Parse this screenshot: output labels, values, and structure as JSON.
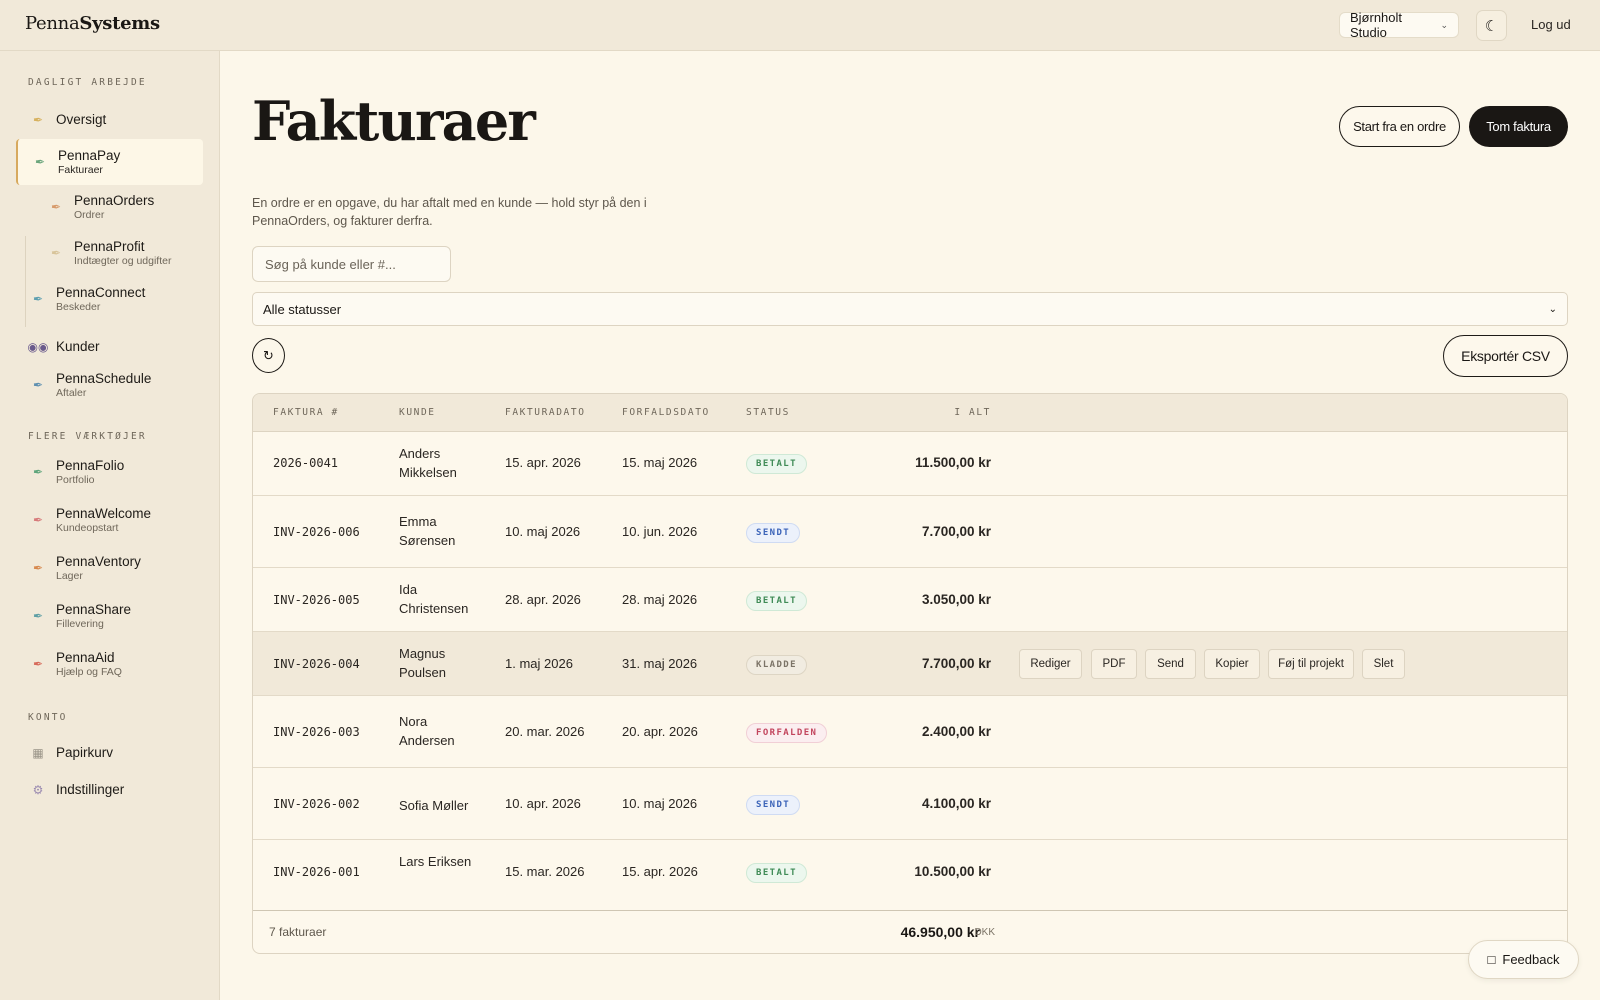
{
  "brand": {
    "light": "Penna",
    "bold": "Systems"
  },
  "header": {
    "workspace": "Bjørnholt Studio",
    "theme_icon": "moon-icon",
    "logout": "Log ud"
  },
  "sidebar": {
    "sections": [
      "DAGLIGT ARBEJDE",
      "FLERE VÆRKTØJER",
      "KONTO"
    ],
    "items": [
      {
        "label": "Oversigt",
        "sub": "",
        "icon": "quill-icon"
      },
      {
        "label": "PennaPay",
        "sub": "Fakturaer",
        "icon": "quill-icon"
      },
      {
        "label": "PennaOrders",
        "sub": "Ordrer",
        "icon": "quill-icon"
      },
      {
        "label": "PennaProfit",
        "sub": "Indtægter og udgifter",
        "icon": "quill-icon"
      },
      {
        "label": "PennaConnect",
        "sub": "Beskeder",
        "icon": "quill-icon"
      },
      {
        "label": "Kunder",
        "sub": "",
        "icon": "people-icon"
      },
      {
        "label": "PennaSchedule",
        "sub": "Aftaler",
        "icon": "quill-icon"
      },
      {
        "label": "PennaFolio",
        "sub": "Portfolio",
        "icon": "quill-icon"
      },
      {
        "label": "PennaWelcome",
        "sub": "Kundeopstart",
        "icon": "quill-icon"
      },
      {
        "label": "PennaVentory",
        "sub": "Lager",
        "icon": "quill-icon"
      },
      {
        "label": "PennaShare",
        "sub": "Fillevering",
        "icon": "quill-icon"
      },
      {
        "label": "PennaAid",
        "sub": "Hjælp og FAQ",
        "icon": "quill-icon"
      },
      {
        "label": "Papirkurv",
        "sub": "",
        "icon": "trash-icon"
      },
      {
        "label": "Indstillinger",
        "sub": "",
        "icon": "gear-icon"
      }
    ]
  },
  "main": {
    "title": "Fakturaer",
    "btn_from_order": "Start fra en ordre",
    "btn_blank": "Tom faktura",
    "intro": "En ordre er en opgave, du har aftalt med en kunde — hold styr på den i PennaOrders, og fakturer derfra.",
    "search_placeholder": "Søg på kunde eller #...",
    "status_filter": "Alle statusser",
    "export": "Eksportér CSV"
  },
  "table": {
    "headers": [
      "FAKTURA #",
      "KUNDE",
      "FAKTURADATO",
      "FORFALDSDATO",
      "STATUS",
      "I ALT"
    ],
    "rows": [
      {
        "id": "2026-0041",
        "kunde": "Anders Mikkelsen",
        "fdate": "15. apr. 2026",
        "ddate": "15. maj 2026",
        "status": "BETALT",
        "total": "11.500,00 kr"
      },
      {
        "id": "INV-2026-006",
        "kunde": "Emma Sørensen",
        "fdate": "10. maj 2026",
        "ddate": "10. jun. 2026",
        "status": "SENDT",
        "total": "7.700,00 kr"
      },
      {
        "id": "INV-2026-005",
        "kunde": "Ida Christensen",
        "fdate": "28. apr. 2026",
        "ddate": "28. maj 2026",
        "status": "BETALT",
        "total": "3.050,00 kr"
      },
      {
        "id": "INV-2026-004",
        "kunde": "Magnus Poulsen",
        "fdate": "1. maj 2026",
        "ddate": "31. maj 2026",
        "status": "KLADDE",
        "total": "7.700,00 kr"
      },
      {
        "id": "INV-2026-003",
        "kunde": "Nora Andersen",
        "fdate": "20. mar. 2026",
        "ddate": "20. apr. 2026",
        "status": "FORFALDEN",
        "total": "2.400,00 kr"
      },
      {
        "id": "INV-2026-002",
        "kunde": "Sofia Møller",
        "fdate": "10. apr. 2026",
        "ddate": "10. maj 2026",
        "status": "SENDT",
        "total": "4.100,00 kr"
      },
      {
        "id": "INV-2026-001",
        "kunde": "Lars Eriksen",
        "fdate": "15. mar. 2026",
        "ddate": "15. apr. 2026",
        "status": "BETALT",
        "total": "10.500,00 kr"
      }
    ],
    "row_actions": [
      "Rediger",
      "PDF",
      "Send",
      "Kopier",
      "Føj til projekt",
      "Slet"
    ],
    "footer_count": "7 fakturaer",
    "footer_total": "46.950,00 kr",
    "footer_currency": "DKK"
  },
  "feedback": "Feedback",
  "colors": {
    "accent": "#d7a95e",
    "dark": "#1a1714",
    "paid": "#3f8b56",
    "sent": "#3b63b8",
    "overdue": "#c2455d"
  }
}
